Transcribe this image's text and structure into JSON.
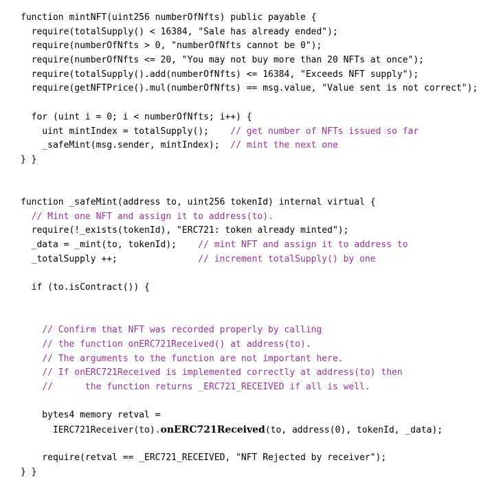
{
  "document": {
    "kind": "code-listing",
    "language": "Solidity",
    "background_color": "#ffffff",
    "code_color": "#000000",
    "comment_color": "#993399"
  },
  "lines": [
    {
      "id": "l1",
      "tokens": [
        {
          "type": "code",
          "text": "function mintNFT(uint256 numberOfNfts) public payable {"
        }
      ]
    },
    {
      "id": "l2",
      "tokens": [
        {
          "type": "code",
          "text": "  require(totalSupply() < 16384, \"Sale has already ended\");"
        }
      ]
    },
    {
      "id": "l3",
      "tokens": [
        {
          "type": "code",
          "text": "  require(numberOfNfts > 0, \"numberOfNfts cannot be 0\");"
        }
      ]
    },
    {
      "id": "l4",
      "tokens": [
        {
          "type": "code",
          "text": "  require(numberOfNfts <= 20, \"You may not buy more than 20 NFTs at once\");"
        }
      ]
    },
    {
      "id": "l5",
      "tokens": [
        {
          "type": "code",
          "text": "  require(totalSupply().add(numberOfNfts) <= 16384, \"Exceeds NFT supply\");"
        }
      ]
    },
    {
      "id": "l6",
      "tokens": [
        {
          "type": "code",
          "text": "  require(getNFTPrice().mul(numberOfNfts) == msg.value, \"Value sent is not correct\");"
        }
      ]
    },
    {
      "id": "l7",
      "blank": true,
      "tokens": [
        {
          "type": "code",
          "text": " "
        }
      ]
    },
    {
      "id": "l8",
      "tokens": [
        {
          "type": "code",
          "text": "  for (uint i = 0; i < numberOfNfts; i++) {"
        }
      ]
    },
    {
      "id": "l9",
      "tokens": [
        {
          "type": "code",
          "text": "    uint mintIndex = totalSupply();    "
        },
        {
          "type": "comment",
          "text": "// get number of NFTs issued so far"
        }
      ]
    },
    {
      "id": "l10",
      "tokens": [
        {
          "type": "code",
          "text": "    _safeMint(msg.sender, mintIndex);  "
        },
        {
          "type": "comment",
          "text": "// mint the next one"
        }
      ]
    },
    {
      "id": "l11",
      "tokens": [
        {
          "type": "code",
          "text": "} }"
        }
      ]
    },
    {
      "id": "l12",
      "blank": true,
      "tokens": [
        {
          "type": "code",
          "text": " "
        }
      ]
    },
    {
      "id": "l13",
      "blank": true,
      "tokens": [
        {
          "type": "code",
          "text": " "
        }
      ]
    },
    {
      "id": "l14",
      "tokens": [
        {
          "type": "code",
          "text": "function _safeMint(address to, uint256 tokenId) internal virtual {"
        }
      ]
    },
    {
      "id": "l15",
      "tokens": [
        {
          "type": "code",
          "text": "  "
        },
        {
          "type": "comment",
          "text": "// Mint one NFT and assign it to address(to)."
        }
      ]
    },
    {
      "id": "l16",
      "tokens": [
        {
          "type": "code",
          "text": "  require(!_exists(tokenId), \"ERC721: token already minted\");"
        }
      ]
    },
    {
      "id": "l17",
      "tokens": [
        {
          "type": "code",
          "text": "  _data = _mint(to, tokenId);    "
        },
        {
          "type": "comment",
          "text": "// mint NFT and assign it to address to"
        }
      ]
    },
    {
      "id": "l18",
      "tokens": [
        {
          "type": "code",
          "text": "  _totalSupply ++;               "
        },
        {
          "type": "comment",
          "text": "// increment totalSupply() by one"
        }
      ]
    },
    {
      "id": "l19",
      "blank": true,
      "tokens": [
        {
          "type": "code",
          "text": " "
        }
      ]
    },
    {
      "id": "l20",
      "tokens": [
        {
          "type": "code",
          "text": "  if (to.isContract()) {"
        }
      ]
    },
    {
      "id": "l21",
      "blank": true,
      "tokens": [
        {
          "type": "code",
          "text": " "
        }
      ]
    },
    {
      "id": "l22",
      "blank": true,
      "tokens": [
        {
          "type": "code",
          "text": " "
        }
      ]
    },
    {
      "id": "l23",
      "tokens": [
        {
          "type": "code",
          "text": "    "
        },
        {
          "type": "comment",
          "text": "// Confirm that NFT was recorded properly by calling"
        }
      ]
    },
    {
      "id": "l24",
      "tokens": [
        {
          "type": "code",
          "text": "    "
        },
        {
          "type": "comment",
          "text": "// the function onERC721Received() at address(to)."
        }
      ]
    },
    {
      "id": "l25",
      "tokens": [
        {
          "type": "code",
          "text": "    "
        },
        {
          "type": "comment",
          "text": "// The arguments to the function are not important here."
        }
      ]
    },
    {
      "id": "l26",
      "tokens": [
        {
          "type": "code",
          "text": "    "
        },
        {
          "type": "comment",
          "text": "// If onERC721Received is implemented correctly at address(to) then"
        }
      ]
    },
    {
      "id": "l27",
      "tokens": [
        {
          "type": "code",
          "text": "    "
        },
        {
          "type": "comment",
          "text": "//      the function returns _ERC721_RECEIVED if all is well."
        }
      ]
    },
    {
      "id": "l28",
      "blank": true,
      "tokens": [
        {
          "type": "code",
          "text": " "
        }
      ]
    },
    {
      "id": "l29",
      "tokens": [
        {
          "type": "code",
          "text": "    bytes4 memory retval ="
        }
      ]
    },
    {
      "id": "l30",
      "tokens": [
        {
          "type": "code",
          "text": "      IERC721Receiver(to)."
        },
        {
          "type": "emph",
          "text": "onERC721Received"
        },
        {
          "type": "code",
          "text": "(to, address(0), tokenId, _data);"
        }
      ]
    },
    {
      "id": "l31",
      "blank": true,
      "tokens": [
        {
          "type": "code",
          "text": " "
        }
      ]
    },
    {
      "id": "l32",
      "tokens": [
        {
          "type": "code",
          "text": "    require(retval == _ERC721_RECEIVED, \"NFT Rejected by receiver\");"
        }
      ]
    },
    {
      "id": "l33",
      "tokens": [
        {
          "type": "code",
          "text": "} }"
        }
      ]
    }
  ]
}
